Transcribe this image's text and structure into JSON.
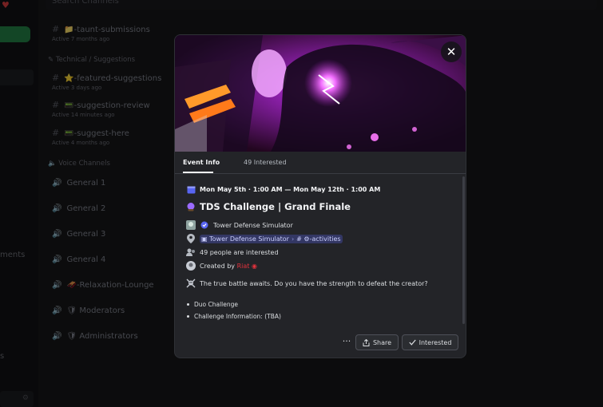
{
  "background": {
    "search_placeholder": "Search Channels",
    "rail_text": "ments",
    "rail_s": "s",
    "channels": [
      {
        "name": "📁-taunt-submissions",
        "sub": "Active 7 months ago"
      },
      {
        "name": "⭐-featured-suggestions",
        "sub": "Active 3 days ago"
      },
      {
        "name": "📟-suggestion-review",
        "sub": "Active 14 minutes ago"
      },
      {
        "name": "📟-suggest-here",
        "sub": "Active 4 months ago"
      }
    ],
    "category_tech": "Technical / Suggestions",
    "category_voice": "Voice Channels",
    "voice_channels": [
      "General 1",
      "General 2",
      "General 3",
      "General 4",
      "🛷-Relaxation-Lounge",
      "🛡 Moderators",
      "🛡 Administrators"
    ]
  },
  "modal": {
    "close_label": "✕",
    "tabs": [
      {
        "label": "Event Info",
        "active": true
      },
      {
        "label": "49 Interested",
        "active": false
      }
    ],
    "date": "Mon May 5th · 1:00 AM — Mon May 12th · 1:00 AM",
    "title": "TDS Challenge | Grand Finale",
    "game": "Tower Defense Simulator",
    "location_game": "Tower Defense Simulator",
    "location_channel": "-activities",
    "location_hash": "#",
    "interested_text": "49 people are interested",
    "created_by_prefix": "Created by",
    "creator": "Riat",
    "description": "The true battle awaits. Do you have the strength to defeat the creator?",
    "bullets": [
      "Duo Challenge",
      "Challenge Information: (TBA)"
    ],
    "more_label": "···",
    "share_label": "Share",
    "interested_label": "Interested"
  },
  "colors": {
    "accent": "#5865f2",
    "creator_red": "#e0323c",
    "banner_purple": "#c02ad8"
  }
}
